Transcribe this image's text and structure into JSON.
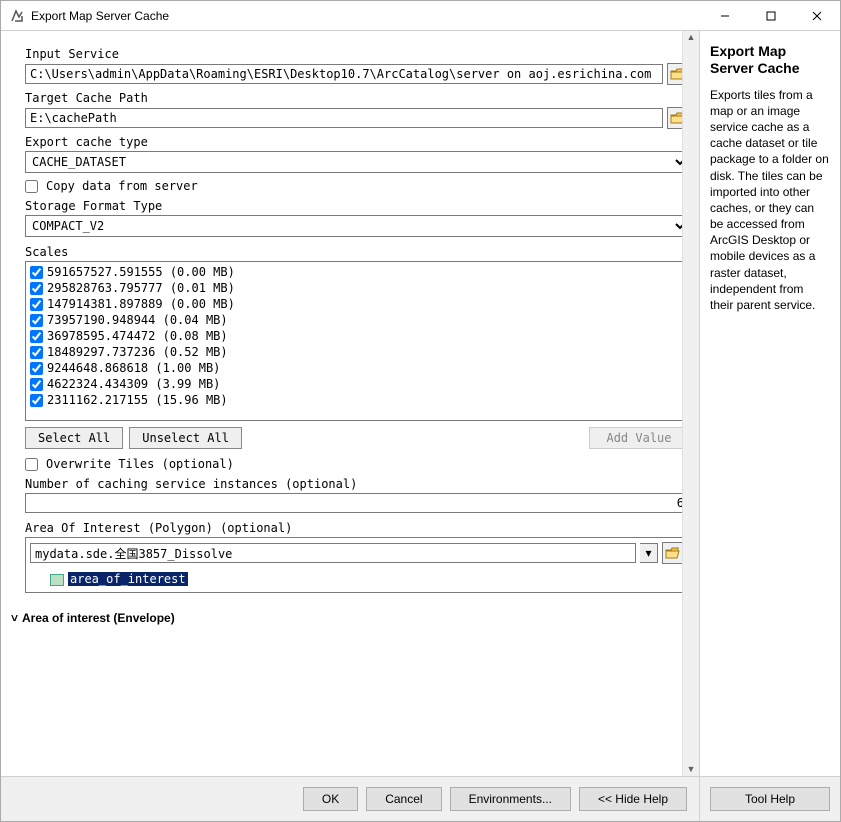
{
  "window": {
    "title": "Export Map Server Cache"
  },
  "form": {
    "input_service_label": "Input Service",
    "input_service_value": "C:\\Users\\admin\\AppData\\Roaming\\ESRI\\Desktop10.7\\ArcCatalog\\server on aoj.esrichina.com (admin)\\cache/",
    "target_cache_label": "Target Cache Path",
    "target_cache_value": "E:\\cachePath",
    "export_type_label": "Export cache type",
    "export_type_value": "CACHE_DATASET",
    "copy_data_label": "Copy data from server",
    "copy_data_checked": false,
    "storage_format_label": "Storage Format Type",
    "storage_format_value": "COMPACT_V2",
    "scales_label": "Scales",
    "scales": [
      {
        "label": "591657527.591555 (0.00 MB)",
        "checked": true
      },
      {
        "label": "295828763.795777 (0.01 MB)",
        "checked": true
      },
      {
        "label": "147914381.897889 (0.00 MB)",
        "checked": true
      },
      {
        "label": "73957190.948944 (0.04 MB)",
        "checked": true
      },
      {
        "label": "36978595.474472 (0.08 MB)",
        "checked": true
      },
      {
        "label": "18489297.737236 (0.52 MB)",
        "checked": true
      },
      {
        "label": "9244648.868618 (1.00 MB)",
        "checked": true
      },
      {
        "label": "4622324.434309 (3.99 MB)",
        "checked": true
      },
      {
        "label": "2311162.217155 (15.96 MB)",
        "checked": true
      }
    ],
    "select_all_label": "Select All",
    "unselect_all_label": "Unselect All",
    "add_value_label": "Add Value",
    "overwrite_label": "Overwrite Tiles (optional)",
    "overwrite_checked": false,
    "instances_label": "Number of caching service instances (optional)",
    "instances_value": "6",
    "aoi_poly_label": "Area Of Interest (Polygon) (optional)",
    "aoi_poly_value": "mydata.sde.全国3857_Dissolve",
    "aoi_sub_value": "area_of_interest",
    "aoi_env_label": "Area of interest (Envelope)"
  },
  "buttons": {
    "ok": "OK",
    "cancel": "Cancel",
    "environments": "Environments...",
    "hide_help": "<< Hide Help",
    "tool_help": "Tool Help"
  },
  "help": {
    "title": "Export Map Server Cache",
    "body": "Exports tiles from a map or an image service cache as a cache dataset or tile package to a folder on disk. The tiles can be imported into other caches, or they can be accessed from ArcGIS Desktop or mobile devices as a raster dataset, independent from their parent service."
  }
}
